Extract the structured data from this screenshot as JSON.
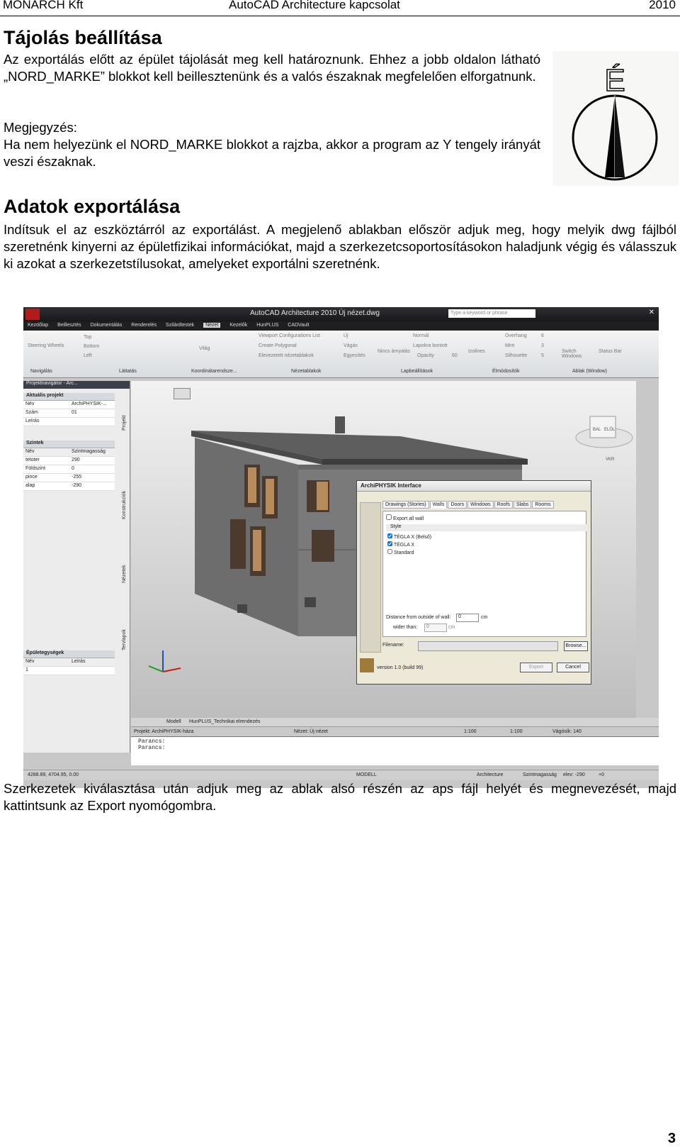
{
  "header": {
    "left": "MONARCH Kft",
    "center": "AutoCAD Architecture kapcsolat",
    "right": "2010"
  },
  "section1": {
    "title": "Tájolás beállítása",
    "paragraph": "Az exportálás előtt az épület tájolását meg kell határoznunk. Ehhez a jobb oldalon látható „NORD_MARKE” blokkot kell beillesztenünk és a valós északnak megfelelően elforgatnunk.",
    "note_label": "Megjegyzés:",
    "note_text": "Ha nem helyezünk el NORD_MARKE blokkot a rajzba, akkor a program az Y tengely irányát veszi északnak."
  },
  "compass": {
    "letter": "É"
  },
  "section2": {
    "title": "Adatok exportálása",
    "paragraph": "Indítsuk el az eszköztárról az exportálást. A megjelenő ablakban először adjuk meg, hogy melyik dwg fájlból szeretnénk kinyerni az épületfizikai információkat, majd a szerkezetcsoportosításokon haladjunk végig és válasszuk ki azokat a szerkezetstílusokat, amelyeket exportálni szeretnénk."
  },
  "screenshot": {
    "window_title": "AutoCAD Architecture 2010   Új nézet.dwg",
    "search_placeholder": "Type a keyword or phrase",
    "menu": [
      "Kezdőlap",
      "Beillesztés",
      "Dokumentálás",
      "Renderelés",
      "Szilárdtestek",
      "Nézet",
      "Kezelők",
      "HunPLUS",
      "CADVault"
    ],
    "menu_active": "Nézet",
    "ribbon_groups": [
      "Navigálás",
      "Láttatás",
      "Koordinátarendsze...",
      "Nézetablakok",
      "Lapbeállítások",
      "Élmódosítók",
      "Ablak (Window)"
    ],
    "ribbon_items": [
      "Steering Wheels",
      "Top",
      "Bottom",
      "Left",
      "Világ",
      "Viewport Configurations List",
      "Create Polygonal",
      "Elevezetett nézetablakok",
      "Új",
      "Vágás",
      "Egyesítés",
      "Nincs árnyalás",
      "Normál",
      "Lapokra bontott",
      "Opacity",
      "Izolines",
      "Overhang",
      "Mint",
      "Silhouette",
      "Switch Windows",
      "Status Bar"
    ],
    "ribbon_values": [
      "60",
      "6",
      "3",
      "5"
    ],
    "panel_title": "Projektnavigátor - Arc...",
    "project": {
      "section": "Aktuális projekt",
      "rows": [
        [
          "Név",
          "ArchiPHYSIK-..."
        ],
        [
          "Szám",
          "01"
        ],
        [
          "Leírás",
          ""
        ]
      ]
    },
    "levels": {
      "section": "Szintek",
      "header": [
        "Név",
        "Szintmagasság"
      ],
      "rows": [
        [
          "tetoter",
          "290"
        ],
        [
          "Földszint",
          "0"
        ],
        [
          "pince",
          "-255"
        ],
        [
          "alap",
          "-290"
        ]
      ]
    },
    "units": {
      "section": "Épületegységek",
      "header": [
        "Név",
        "Leírás"
      ],
      "rows": [
        [
          "1",
          ""
        ]
      ]
    },
    "side_tabs": [
      "Projekt",
      "Konstrukciók",
      "Nézetek",
      "Tervlapok"
    ],
    "viewcube": [
      "BAL",
      "ELŐL",
      "VKR"
    ],
    "dialog": {
      "title": "ArchiPHYSIK Interface",
      "tabs": [
        "Drawings (Stories)",
        "Walls",
        "Doors",
        "Windows",
        "Roofs",
        "Slabs",
        "Rooms"
      ],
      "active_tab": "Walls",
      "export_all_label": "Export all wall",
      "style_header": "Style",
      "styles": [
        {
          "label": "TÉGLA X (Belső)",
          "checked": true
        },
        {
          "label": "TÉGLA X",
          "checked": true
        },
        {
          "label": "Standard",
          "checked": false
        }
      ],
      "distance_label": "Distance from outside of wall:",
      "distance_value": "0",
      "distance_unit": "cm",
      "wider_label": "wider than:",
      "wider_value": "0",
      "wider_unit": "cm",
      "filename_label": "Filename:",
      "browse": "Browse...",
      "version": "version 1.0 (build 99)",
      "export": "Export",
      "cancel": "Cancel"
    },
    "layout_tabs": [
      "Modell",
      "HunPLUS_Technikai elrendezés"
    ],
    "status": {
      "project": "Projekt: ArchiPHYSIK-háza",
      "view": "Nézet: Új nézet",
      "scale1": "1:100",
      "scale2": "1:100",
      "cut": "Vágósík: 140"
    },
    "command_lines": [
      "Parancs:",
      "Parancs:"
    ],
    "coords": "4288.89, 4704.95, 0.00",
    "model": "MODELL",
    "architecture": "Architecture",
    "level_indicator": "Szintmagasság",
    "elev": "elev: -290",
    "plus": "+0"
  },
  "section3": {
    "paragraph": "Szerkezetek kiválasztása után adjuk meg az ablak alsó részén az aps fájl helyét és megnevezését, majd kattintsunk az Export nyomógombra."
  },
  "page_number": "3"
}
